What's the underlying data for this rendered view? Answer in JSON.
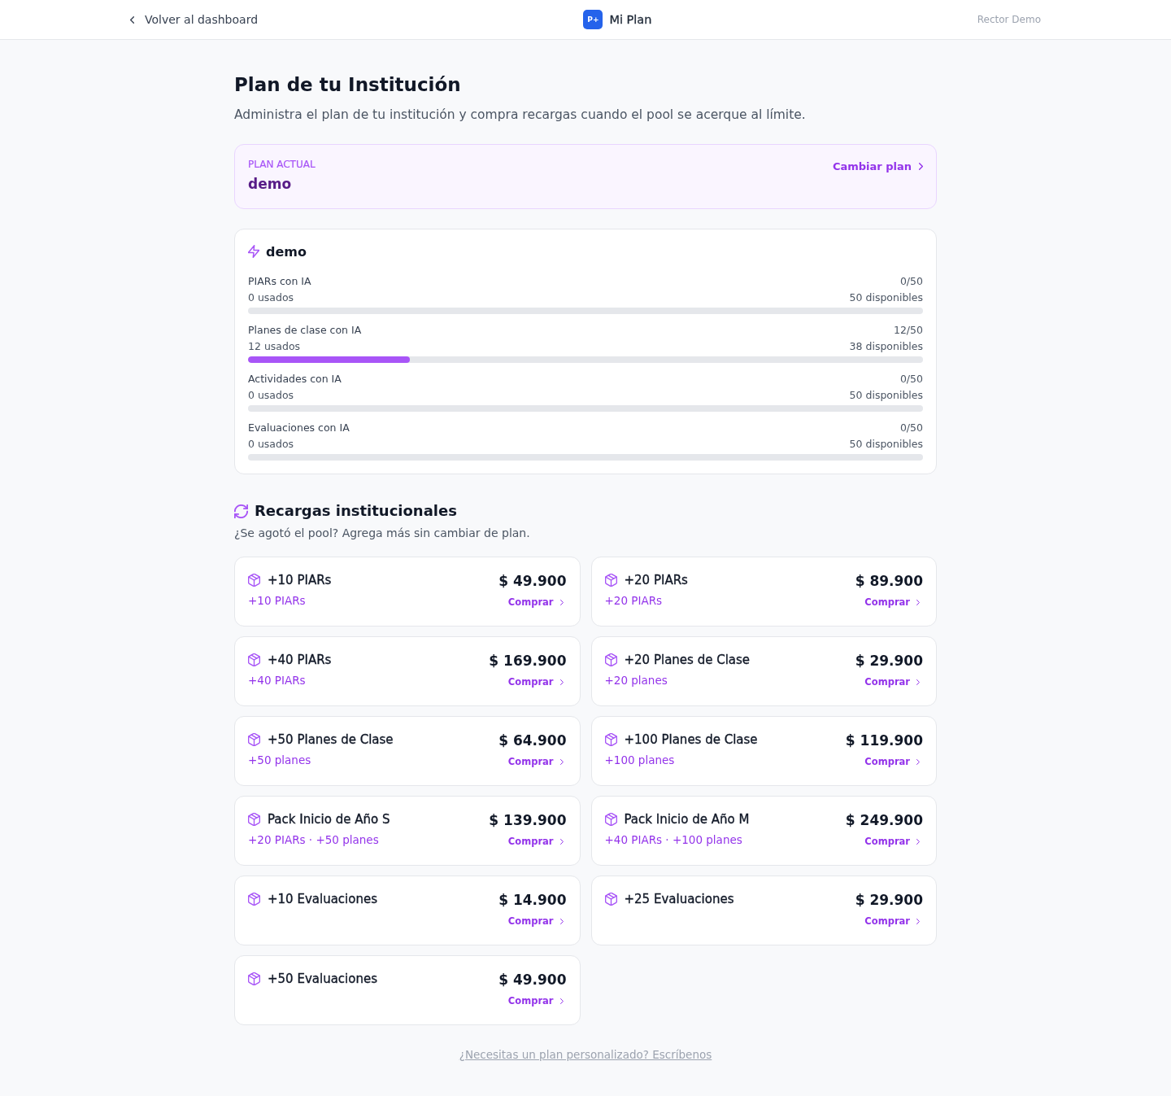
{
  "header": {
    "back_link": "Volver al dashboard",
    "logo_text": "P+",
    "app_title": "Mi Plan",
    "user_name": "Rector Demo"
  },
  "page": {
    "title": "Plan de tu Institución",
    "subtitle": "Administra el plan de tu institución y compra recargas cuando el pool se acerque al límite."
  },
  "current_plan": {
    "label": "PLAN ACTUAL",
    "name": "demo",
    "change_link": "Cambiar plan"
  },
  "usage": {
    "plan_name": "demo",
    "quotas": [
      {
        "name": "PIARs con IA",
        "ratio": "0/50",
        "used": "0 usados",
        "available": "50 disponibles",
        "level": 0
      },
      {
        "name": "Planes de clase con IA",
        "ratio": "12/50",
        "used": "12 usados",
        "available": "38 disponibles",
        "level": 0.24
      },
      {
        "name": "Actividades con IA",
        "ratio": "0/50",
        "used": "0 usados",
        "available": "50 disponibles",
        "level": 0
      },
      {
        "name": "Evaluaciones con IA",
        "ratio": "0/50",
        "used": "0 usados",
        "available": "50 disponibles",
        "level": 0
      }
    ]
  },
  "recharges": {
    "title": "Recargas institucionales",
    "subtitle": "¿Se agotó el pool? Agrega más sin cambiar de plan.",
    "packs": [
      {
        "name": "+10 PIARs",
        "detail": "+10 PIARs",
        "price": "$ 49.900",
        "action": "Comprar"
      },
      {
        "name": "+20 PIARs",
        "detail": "+20 PIARs",
        "price": "$ 89.900",
        "action": "Comprar"
      },
      {
        "name": "+40 PIARs",
        "detail": "+40 PIARs",
        "price": "$ 169.900",
        "action": "Comprar"
      },
      {
        "name": "+20 Planes de Clase",
        "detail": "+20 planes",
        "price": "$ 29.900",
        "action": "Comprar"
      },
      {
        "name": "+50 Planes de Clase",
        "detail": "+50 planes",
        "price": "$ 64.900",
        "action": "Comprar"
      },
      {
        "name": "+100 Planes de Clase",
        "detail": "+100 planes",
        "price": "$ 119.900",
        "action": "Comprar"
      },
      {
        "name": "Pack Inicio de Año S",
        "detail": "+20 PIARs · +50 planes",
        "price": "$ 139.900",
        "action": "Comprar"
      },
      {
        "name": "Pack Inicio de Año M",
        "detail": "+40 PIARs · +100 planes",
        "price": "$ 249.900",
        "action": "Comprar"
      },
      {
        "name": "+10 Evaluaciones",
        "price": "$ 14.900",
        "action": "Comprar"
      },
      {
        "name": "+25 Evaluaciones",
        "price": "$ 29.900",
        "action": "Comprar"
      },
      {
        "name": "+50 Evaluaciones",
        "price": "$ 49.900",
        "action": "Comprar"
      }
    ]
  },
  "footer_link": "¿Necesitas un plan personalizado? Escríbenos"
}
